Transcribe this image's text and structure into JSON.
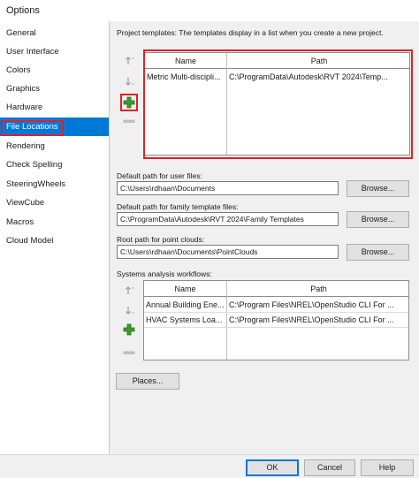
{
  "window": {
    "title": "Options"
  },
  "sidebar": {
    "items": [
      {
        "label": "General"
      },
      {
        "label": "User Interface"
      },
      {
        "label": "Colors"
      },
      {
        "label": "Graphics"
      },
      {
        "label": "Hardware"
      },
      {
        "label": "File Locations"
      },
      {
        "label": "Rendering"
      },
      {
        "label": "Check Spelling"
      },
      {
        "label": "SteeringWheels"
      },
      {
        "label": "ViewCube"
      },
      {
        "label": "Macros"
      },
      {
        "label": "Cloud Model"
      }
    ],
    "selected": "File Locations"
  },
  "project_templates": {
    "description": "Project templates:  The templates display in a list when you create a new project.",
    "columns": [
      "Name",
      "Path"
    ],
    "rows": [
      {
        "name": "Metric Multi-discipli...",
        "path": "C:\\ProgramData\\Autodesk\\RVT 2024\\Temp..."
      }
    ]
  },
  "user_files": {
    "label": "Default path for user files:",
    "value": "C:\\Users\\rdhaan\\Documents",
    "browse": "Browse..."
  },
  "family_templates": {
    "label": "Default path for family template files:",
    "value": "C:\\ProgramData\\Autodesk\\RVT 2024\\Family Templates",
    "browse": "Browse..."
  },
  "point_clouds": {
    "label": "Root path for point clouds:",
    "value": "C:\\Users\\rdhaan\\Documents\\PointClouds",
    "browse": "Browse..."
  },
  "analysis_workflows": {
    "label": "Systems analysis workflows:",
    "columns": [
      "Name",
      "Path"
    ],
    "rows": [
      {
        "name": "Annual Building Ene...",
        "path": "C:\\Program Files\\NREL\\OpenStudio CLI For ..."
      },
      {
        "name": "HVAC Systems Loa...",
        "path": "C:\\Program Files\\NREL\\OpenStudio CLI For ..."
      }
    ]
  },
  "places_button": "Places...",
  "footer": {
    "ok": "OK",
    "cancel": "Cancel",
    "help": "Help"
  },
  "colors": {
    "selection": "#0078d7",
    "highlight": "#e0202a",
    "add_icon": "#3c9a2c"
  },
  "icons": [
    "move-up-icon",
    "move-down-icon",
    "add-icon",
    "remove-icon"
  ]
}
